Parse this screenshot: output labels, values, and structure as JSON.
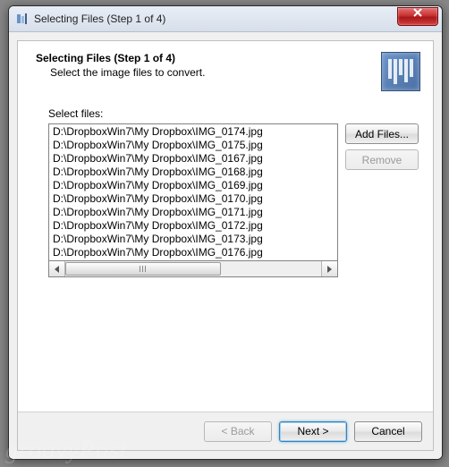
{
  "window": {
    "title": "Selecting Files (Step 1 of 4)"
  },
  "header": {
    "heading": "Selecting Files (Step 1 of 4)",
    "sub": "Select the image files to convert."
  },
  "select_label": "Select files:",
  "files": [
    "D:\\DropboxWin7\\My Dropbox\\IMG_0174.jpg",
    "D:\\DropboxWin7\\My Dropbox\\IMG_0175.jpg",
    "D:\\DropboxWin7\\My Dropbox\\IMG_0167.jpg",
    "D:\\DropboxWin7\\My Dropbox\\IMG_0168.jpg",
    "D:\\DropboxWin7\\My Dropbox\\IMG_0169.jpg",
    "D:\\DropboxWin7\\My Dropbox\\IMG_0170.jpg",
    "D:\\DropboxWin7\\My Dropbox\\IMG_0171.jpg",
    "D:\\DropboxWin7\\My Dropbox\\IMG_0172.jpg",
    "D:\\DropboxWin7\\My Dropbox\\IMG_0173.jpg",
    "D:\\DropboxWin7\\My Dropbox\\IMG_0176.jpg"
  ],
  "buttons": {
    "add_files": "Add Files...",
    "remove": "Remove",
    "back": "< Back",
    "next": "Next >",
    "cancel": "Cancel"
  },
  "watermark": "groovyPost"
}
